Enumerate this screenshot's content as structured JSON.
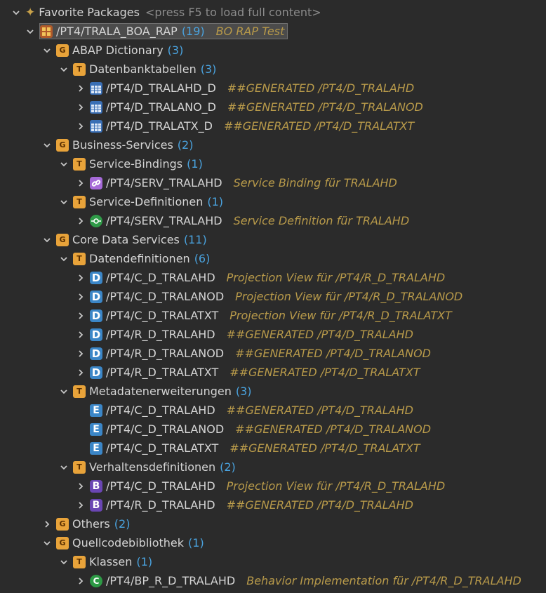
{
  "tree": [
    {
      "id": "fav",
      "indent": 16,
      "tw": "open",
      "icon": "star-icon",
      "label": "Favorite Packages",
      "count": "",
      "hint": "<press F5 to load full content>",
      "desc": ""
    },
    {
      "id": "pkg",
      "indent": 36,
      "tw": "open",
      "icon": "package-icon",
      "label": "/PT4/TRALA_BOA_RAP",
      "count": "(19)",
      "hint": "",
      "desc": "BO RAP Test",
      "selected": true
    },
    {
      "id": "dict",
      "indent": 60,
      "tw": "open",
      "icon": "group-icon",
      "label": "ABAP Dictionary",
      "count": "(3)",
      "desc": ""
    },
    {
      "id": "dbt",
      "indent": 84,
      "tw": "open",
      "icon": "type-icon",
      "label": "Datenbanktabellen",
      "count": "(3)",
      "desc": ""
    },
    {
      "id": "t1",
      "indent": 108,
      "tw": "closed",
      "icon": "table-icon",
      "label": "/PT4/D_TRALAHD_D",
      "count": "",
      "desc": "##GENERATED /PT4/D_TRALAHD"
    },
    {
      "id": "t2",
      "indent": 108,
      "tw": "closed",
      "icon": "table-icon",
      "label": "/PT4/D_TRALANO_D",
      "count": "",
      "desc": "##GENERATED /PT4/D_TRALANOD"
    },
    {
      "id": "t3",
      "indent": 108,
      "tw": "closed",
      "icon": "table-icon",
      "label": "/PT4/D_TRALATX_D",
      "count": "",
      "desc": "##GENERATED /PT4/D_TRALATXT"
    },
    {
      "id": "bs",
      "indent": 60,
      "tw": "open",
      "icon": "group-icon",
      "label": "Business-Services",
      "count": "(2)",
      "desc": ""
    },
    {
      "id": "sb",
      "indent": 84,
      "tw": "open",
      "icon": "type-icon",
      "label": "Service-Bindings",
      "count": "(1)",
      "desc": ""
    },
    {
      "id": "sb1",
      "indent": 108,
      "tw": "closed",
      "icon": "service-binding-icon",
      "label": "/PT4/SERV_TRALAHD",
      "count": "",
      "desc": "Service Binding für TRALAHD"
    },
    {
      "id": "sd",
      "indent": 84,
      "tw": "open",
      "icon": "type-icon",
      "label": "Service-Definitionen",
      "count": "(1)",
      "desc": ""
    },
    {
      "id": "sd1",
      "indent": 108,
      "tw": "closed",
      "icon": "service-definition-icon",
      "label": "/PT4/SERV_TRALAHD",
      "count": "",
      "desc": "Service Definition für TRALAHD"
    },
    {
      "id": "cds",
      "indent": 60,
      "tw": "open",
      "icon": "group-icon",
      "label": "Core Data Services",
      "count": "(11)",
      "desc": ""
    },
    {
      "id": "dd",
      "indent": 84,
      "tw": "open",
      "icon": "type-icon",
      "label": "Datendefinitionen",
      "count": "(6)",
      "desc": ""
    },
    {
      "id": "d1",
      "indent": 108,
      "tw": "closed",
      "icon": "data-definition-icon",
      "label": "/PT4/C_D_TRALAHD",
      "count": "",
      "desc": "Projection View für /PT4/R_D_TRALAHD"
    },
    {
      "id": "d2",
      "indent": 108,
      "tw": "closed",
      "icon": "data-definition-icon",
      "label": "/PT4/C_D_TRALANOD",
      "count": "",
      "desc": "Projection View für /PT4/R_D_TRALANOD"
    },
    {
      "id": "d3",
      "indent": 108,
      "tw": "closed",
      "icon": "data-definition-icon",
      "label": "/PT4/C_D_TRALATXT",
      "count": "",
      "desc": "Projection View für /PT4/R_D_TRALATXT"
    },
    {
      "id": "d4",
      "indent": 108,
      "tw": "closed",
      "icon": "data-definition-icon",
      "label": "/PT4/R_D_TRALAHD",
      "count": "",
      "desc": "##GENERATED /PT4/D_TRALAHD"
    },
    {
      "id": "d5",
      "indent": 108,
      "tw": "closed",
      "icon": "data-definition-icon",
      "label": "/PT4/R_D_TRALANOD",
      "count": "",
      "desc": "##GENERATED /PT4/D_TRALANOD"
    },
    {
      "id": "d6",
      "indent": 108,
      "tw": "closed",
      "icon": "data-definition-icon",
      "label": "/PT4/R_D_TRALATXT",
      "count": "",
      "desc": "##GENERATED /PT4/D_TRALATXT"
    },
    {
      "id": "me",
      "indent": 84,
      "tw": "open",
      "icon": "type-icon",
      "label": "Metadatenerweiterungen",
      "count": "(3)",
      "desc": ""
    },
    {
      "id": "e1",
      "indent": 108,
      "tw": "none",
      "icon": "metadata-extension-icon",
      "label": "/PT4/C_D_TRALAHD",
      "count": "",
      "desc": "##GENERATED /PT4/D_TRALAHD"
    },
    {
      "id": "e2",
      "indent": 108,
      "tw": "none",
      "icon": "metadata-extension-icon",
      "label": "/PT4/C_D_TRALANOD",
      "count": "",
      "desc": "##GENERATED /PT4/D_TRALANOD"
    },
    {
      "id": "e3",
      "indent": 108,
      "tw": "none",
      "icon": "metadata-extension-icon",
      "label": "/PT4/C_D_TRALATXT",
      "count": "",
      "desc": "##GENERATED /PT4/D_TRALATXT"
    },
    {
      "id": "vd",
      "indent": 84,
      "tw": "open",
      "icon": "type-icon",
      "label": "Verhaltensdefinitionen",
      "count": "(2)",
      "desc": ""
    },
    {
      "id": "b1",
      "indent": 108,
      "tw": "closed",
      "icon": "behavior-definition-icon",
      "label": "/PT4/C_D_TRALAHD",
      "count": "",
      "desc": "Projection View für /PT4/R_D_TRALAHD"
    },
    {
      "id": "b2",
      "indent": 108,
      "tw": "closed",
      "icon": "behavior-definition-icon",
      "label": "/PT4/R_D_TRALAHD",
      "count": "",
      "desc": "##GENERATED /PT4/D_TRALAHD"
    },
    {
      "id": "oth",
      "indent": 60,
      "tw": "closed",
      "icon": "group-icon",
      "label": "Others",
      "count": "(2)",
      "desc": ""
    },
    {
      "id": "qb",
      "indent": 60,
      "tw": "open",
      "icon": "group-icon",
      "label": "Quellcodebibliothek",
      "count": "(1)",
      "desc": ""
    },
    {
      "id": "kl",
      "indent": 84,
      "tw": "open",
      "icon": "type-icon",
      "label": "Klassen",
      "count": "(1)",
      "desc": ""
    },
    {
      "id": "c1",
      "indent": 108,
      "tw": "closed",
      "icon": "class-icon",
      "label": "/PT4/BP_R_D_TRALAHD",
      "count": "",
      "desc": "Behavior Implementation für /PT4/R_D_TRALAHD"
    }
  ]
}
